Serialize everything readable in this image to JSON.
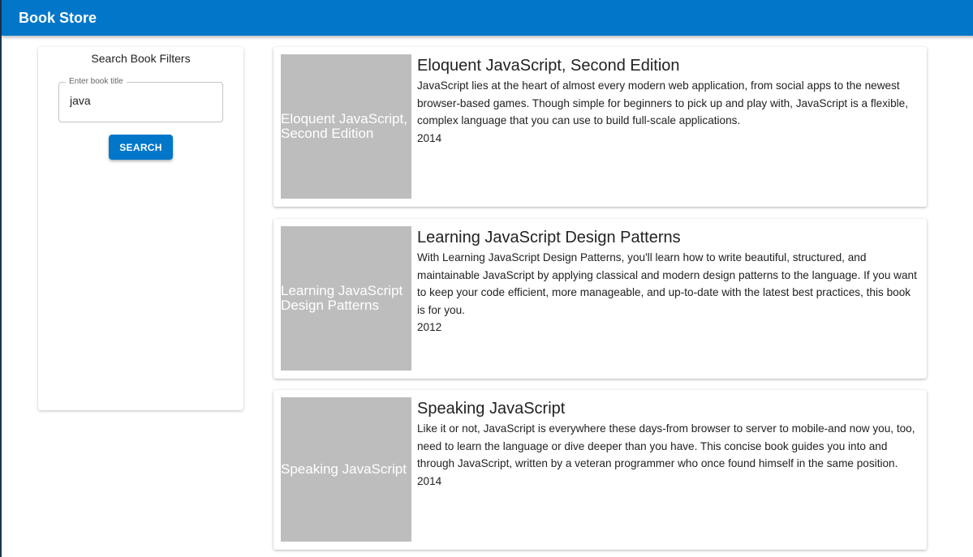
{
  "app": {
    "title": "Book Store"
  },
  "filters": {
    "heading": "Search Book Filters",
    "title_field": {
      "label": "Enter book title",
      "value": "java"
    },
    "search_label": "SEARCH"
  },
  "books": [
    {
      "title": "Eloquent JavaScript, Second Edition",
      "description": "JavaScript lies at the heart of almost every modern web application, from social apps to the newest browser-based games. Though simple for beginners to pick up and play with, JavaScript is a flexible, complex language that you can use to build full-scale applications.",
      "year": "2014"
    },
    {
      "title": "Learning JavaScript Design Patterns",
      "description": "With Learning JavaScript Design Patterns, you'll learn how to write beautiful, structured, and maintainable JavaScript by applying classical and modern design patterns to the language. If you want to keep your code efficient, more manageable, and up-to-date with the latest best practices, this book is for you.",
      "year": "2012"
    },
    {
      "title": "Speaking JavaScript",
      "description": "Like it or not, JavaScript is everywhere these days-from browser to server to mobile-and now you, too, need to learn the language or dive deeper than you have. This concise book guides you into and through JavaScript, written by a veteran programmer who once found himself in the same position.",
      "year": "2014"
    }
  ]
}
